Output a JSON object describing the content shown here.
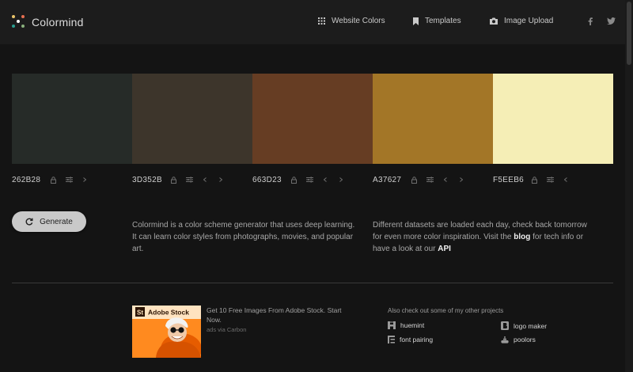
{
  "app": {
    "name": "Colormind"
  },
  "nav": {
    "links": [
      {
        "label": "Website Colors",
        "icon": "grid-icon"
      },
      {
        "label": "Templates",
        "icon": "bookmark-icon"
      },
      {
        "label": "Image Upload",
        "icon": "camera-icon"
      }
    ],
    "social": [
      "facebook-icon",
      "twitter-icon"
    ]
  },
  "palette": [
    {
      "hex": "262B28",
      "color": "#262B28"
    },
    {
      "hex": "3D352B",
      "color": "#3D352B"
    },
    {
      "hex": "663D23",
      "color": "#663D23"
    },
    {
      "hex": "A37627",
      "color": "#A37627"
    },
    {
      "hex": "F5EEB6",
      "color": "#F5EEB6"
    }
  ],
  "generate": {
    "label": "Generate"
  },
  "about": {
    "text": "Colormind is a color scheme generator that uses deep learning. It can learn color styles from photographs, movies, and popular art."
  },
  "datasets": {
    "text_before": "Different datasets are loaded each day, check back tomorrow for even more color inspiration. Visit the ",
    "blog_link": "blog",
    "text_middle": " for tech info or have a look at our ",
    "api_link": "API"
  },
  "ad": {
    "image_text": "Adobe Stock",
    "badge": "St",
    "text": "Get 10 Free Images From Adobe Stock. Start Now.",
    "via": "ads via Carbon"
  },
  "projects": {
    "title": "Also check out some of my other projects",
    "items": [
      {
        "label": "huemint",
        "icon": "huemint-icon"
      },
      {
        "label": "logo maker",
        "icon": "logo-maker-icon"
      },
      {
        "label": "font pairing",
        "icon": "font-pairing-icon"
      },
      {
        "label": "poolors",
        "icon": "poolors-icon"
      }
    ]
  }
}
